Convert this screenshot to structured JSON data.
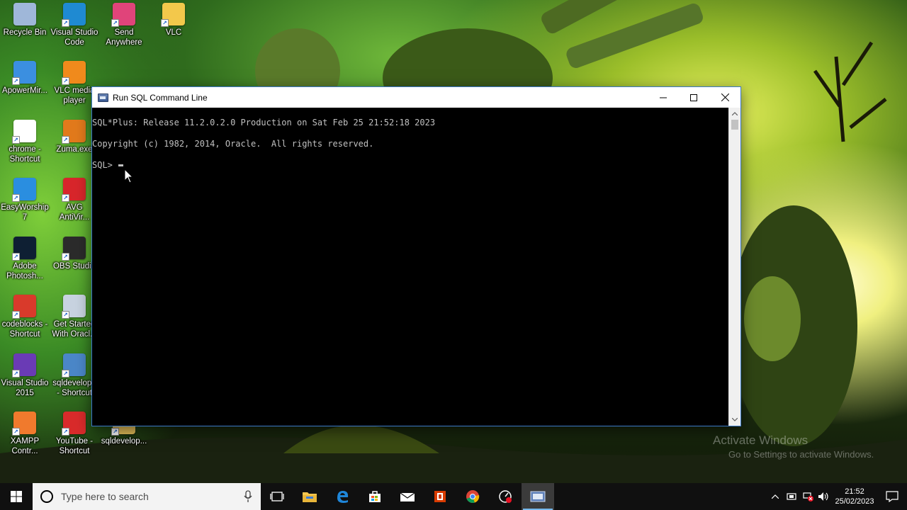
{
  "desktop": {
    "icons": [
      {
        "label": "Recycle Bin",
        "icon": "recycle-bin-icon",
        "color": "#9fb7d9"
      },
      {
        "label": "Visual Studio\nCode",
        "icon": "vscode-icon",
        "color": "#1f8ad2"
      },
      {
        "label": "Send\nAnywhere",
        "icon": "send-anywhere-icon",
        "color": "#e0447a"
      },
      {
        "label": "VLC",
        "icon": "vlc-file-icon",
        "color": "#f3c84b"
      },
      {
        "label": "ApowerMir...",
        "icon": "apowermirror-icon",
        "color": "#3b8fe0"
      },
      {
        "label": "VLC media\nplayer",
        "icon": "vlc-cone-icon",
        "color": "#f08a1c"
      },
      {
        "label": "chrome -\nShortcut",
        "icon": "chrome-icon",
        "color": "#ffffff"
      },
      {
        "label": "Zuma.exe",
        "icon": "zuma-icon",
        "color": "#e27a1c"
      },
      {
        "label": "EasyWorship\n7",
        "icon": "easyworship-icon",
        "color": "#2a8ee0"
      },
      {
        "label": "AVG\nAntiVir...",
        "icon": "avg-icon",
        "color": "#d8262b"
      },
      {
        "label": "Adobe\nPhotosh...",
        "icon": "photoshop-icon",
        "color": "#0e1f33"
      },
      {
        "label": "OBS Studio",
        "icon": "obs-icon",
        "color": "#2b2b2b"
      },
      {
        "label": "codeblocks -\nShortcut",
        "icon": "codeblocks-icon",
        "color": "#d93a2b"
      },
      {
        "label": "Get Started\nWith Oracl...",
        "icon": "oracle-db-icon",
        "color": "#c8d3e0"
      },
      {
        "label": "Visual Studio\n2015",
        "icon": "visual-studio-icon",
        "color": "#6a3bb5"
      },
      {
        "label": "sqldevelope\n- Shortcut",
        "icon": "sqldeveloper-icon",
        "color": "#4b87c8"
      },
      {
        "label": "XAMPP\nContr...",
        "icon": "xampp-icon",
        "color": "#f07a2d"
      },
      {
        "label": "YouTube -\nShortcut",
        "icon": "youtube-icon",
        "color": "#d92b2b"
      },
      {
        "label": "sqldevelop...",
        "icon": "folder-icon",
        "color": "#e8c25a"
      }
    ]
  },
  "window": {
    "title": "Run SQL Command Line",
    "minimize_label": "minimize",
    "lines": [
      "SQL*Plus: Release 11.2.0.2.0 Production on Sat Feb 25 21:52:18 2023",
      "Copyright (c) 1982, 2014, Oracle.  All rights reserved."
    ],
    "prompt": "SQL> "
  },
  "watermark": {
    "line1": "Activate Windows",
    "line2": "Go to Settings to activate Windows."
  },
  "taskbar": {
    "search_placeholder": "Type here to search",
    "time": "21:52",
    "date": "25/02/2023",
    "accent": "#76b9ed"
  }
}
